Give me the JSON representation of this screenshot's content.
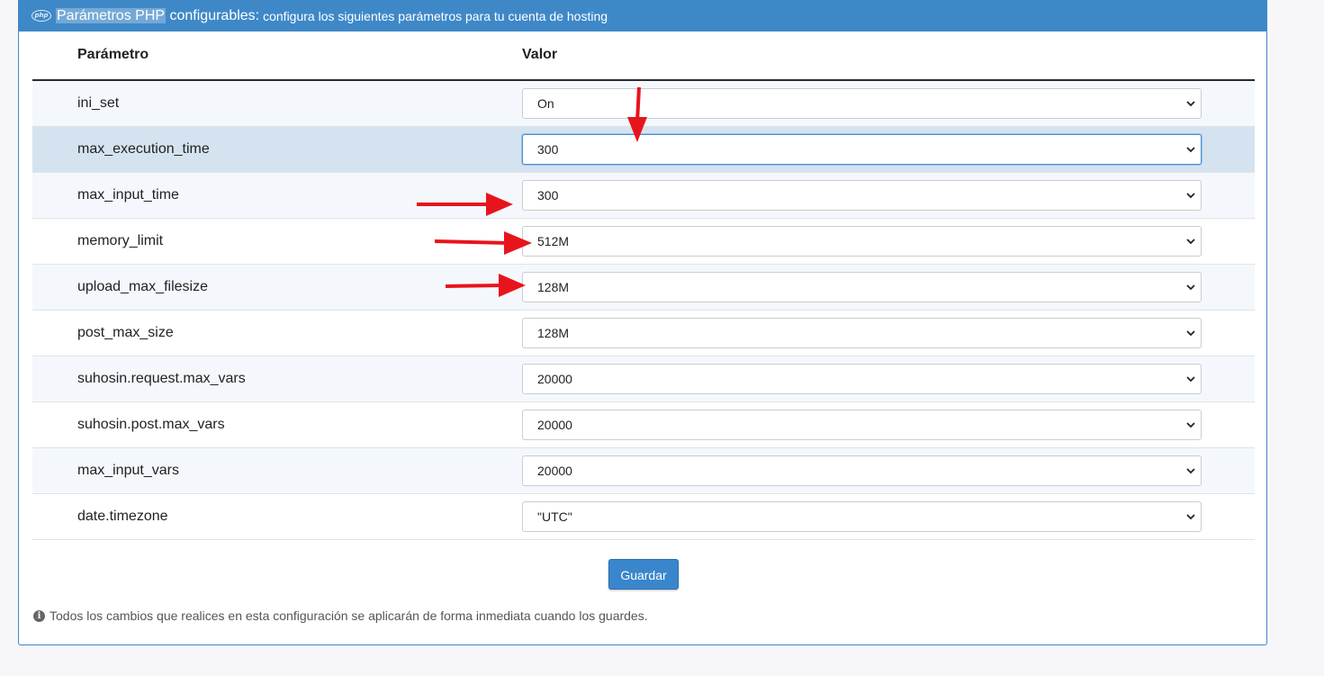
{
  "header": {
    "icon": "php-icon",
    "title_highlight": "Parámetros PHP",
    "title_rest": " configurables:",
    "subtitle": "configura los siguientes parámetros para tu cuenta de hosting"
  },
  "table": {
    "col_param": "Parámetro",
    "col_value": "Valor",
    "rows": [
      {
        "name": "ini_set",
        "value": "On"
      },
      {
        "name": "max_execution_time",
        "value": "300"
      },
      {
        "name": "max_input_time",
        "value": "300"
      },
      {
        "name": "memory_limit",
        "value": "512M"
      },
      {
        "name": "upload_max_filesize",
        "value": "128M"
      },
      {
        "name": "post_max_size",
        "value": "128M"
      },
      {
        "name": "suhosin.request.max_vars",
        "value": "20000"
      },
      {
        "name": "suhosin.post.max_vars",
        "value": "20000"
      },
      {
        "name": "max_input_vars",
        "value": "20000"
      },
      {
        "name": "date.timezone",
        "value": "\"UTC\""
      }
    ]
  },
  "actions": {
    "save_label": "Guardar"
  },
  "note": {
    "icon": "info-icon",
    "text": "Todos los cambios que realices en esta configuración se aplicarán de forma inmediata cuando los guardes."
  },
  "colors": {
    "header_bg": "#3f88c8",
    "button_bg": "#3a86cc",
    "arrow": "#e8141c",
    "active_row": "#d5e3f0"
  }
}
